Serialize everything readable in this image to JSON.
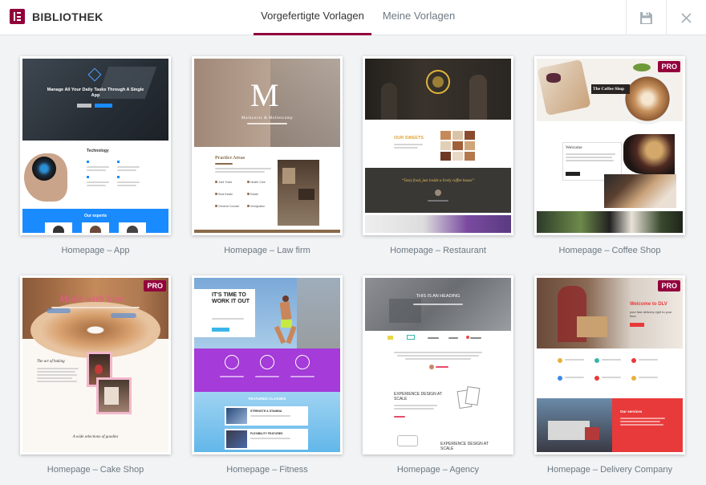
{
  "header": {
    "logo_letter": "E",
    "title": "BIBLIOTHEK",
    "tabs": [
      {
        "label": "Vorgefertigte Vorlagen",
        "active": true
      },
      {
        "label": "Meine Vorlagen",
        "active": false
      }
    ],
    "save_icon": "save-icon",
    "close_icon": "close-icon",
    "accent_color": "#93003c"
  },
  "pro_badge": "PRO",
  "templates": [
    {
      "label": "Homepage – App",
      "hero_text": "Manage All Your Daily Tasks Through A Single App",
      "section_title": "Technology",
      "footer_title": "Our experts"
    },
    {
      "label": "Homepage – Law firm",
      "monogram": "M",
      "brand": "Markowitz & Mellencamp",
      "section_title": "Practice Areas",
      "areas": [
        "Joint Trade",
        "Health Care",
        "Real Estate",
        "Estate",
        "General Counsel",
        "Immigration"
      ]
    },
    {
      "label": "Homepage – Restaurant",
      "sweets_title": "OUR SWEETS",
      "quote": "“Tasty food, just inside a lively coffee house”"
    },
    {
      "label": "Homepage – Coffee Shop",
      "pro": true,
      "hero_text": "The Coffee Shop",
      "welcome": "Welcome"
    },
    {
      "label": "Homepage – Cake Shop",
      "pro": true,
      "hero_text": "Made with love",
      "art_title": "The art of baking",
      "footer_text": "A wide selections of goodies"
    },
    {
      "label": "Homepage – Fitness",
      "hero_text": "IT'S TIME TO WORK IT OUT",
      "featured": "FEATURED CLASSES",
      "class_1": "STRENGTH & STAMINA",
      "class_2": "FLEXIBILITY FEATURES"
    },
    {
      "label": "Homepage – Agency",
      "hero_text": "THIS IS AN HEADING",
      "section_1": "EXPERIENCE DESIGN AT SCALE",
      "section_2": "EXPERIENCE DESIGN AT SCALE"
    },
    {
      "label": "Homepage – Delivery Company",
      "pro": true,
      "hero_text": "Welcome to DLV",
      "hero_sub": "your fast delivery right to your floor",
      "services": "Our services"
    }
  ]
}
